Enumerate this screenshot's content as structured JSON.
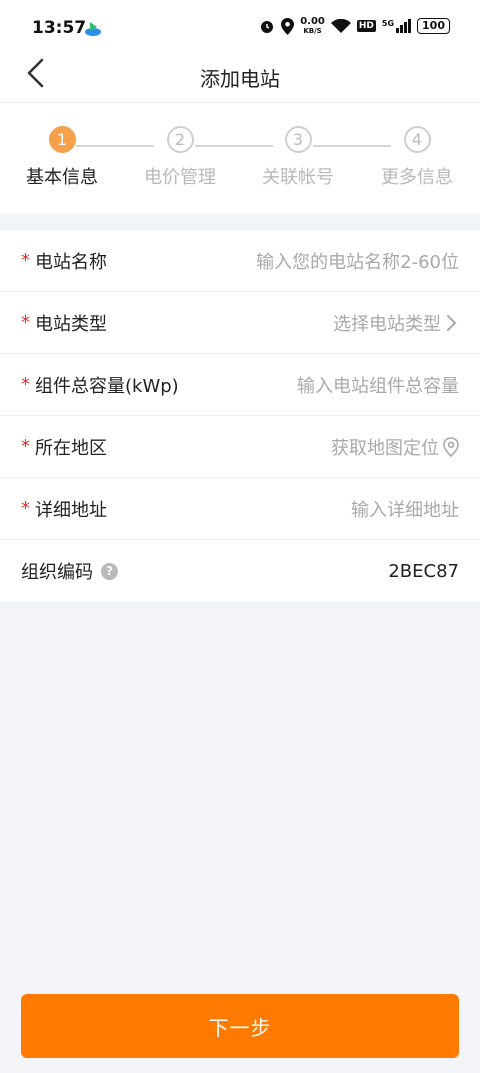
{
  "status_bar": {
    "time": "13:57",
    "speed_value": "0.00",
    "speed_unit": "KB/S",
    "hd": "HD",
    "network": "5G",
    "battery": "100"
  },
  "header": {
    "title": "添加电站"
  },
  "steps": [
    {
      "number": "1",
      "label": "基本信息",
      "active": true
    },
    {
      "number": "2",
      "label": "电价管理",
      "active": false
    },
    {
      "number": "3",
      "label": "关联帐号",
      "active": false
    },
    {
      "number": "4",
      "label": "更多信息",
      "active": false
    }
  ],
  "form": {
    "required_mark": "*",
    "station_name": {
      "label": "电站名称",
      "placeholder": "输入您的电站名称2-60位"
    },
    "station_type": {
      "label": "电站类型",
      "placeholder": "选择电站类型"
    },
    "capacity": {
      "label": "组件总容量(kWp)",
      "placeholder": "输入电站组件总容量"
    },
    "region": {
      "label": "所在地区",
      "placeholder": "获取地图定位"
    },
    "address": {
      "label": "详细地址",
      "placeholder": "输入详细地址"
    },
    "org_code": {
      "label": "组织编码",
      "help": "?",
      "value": "2BEC87"
    }
  },
  "actions": {
    "next_label": "下一步"
  },
  "colors": {
    "accent": "#ff7a00",
    "step_active": "#f5a04a",
    "required": "#e0302d"
  }
}
